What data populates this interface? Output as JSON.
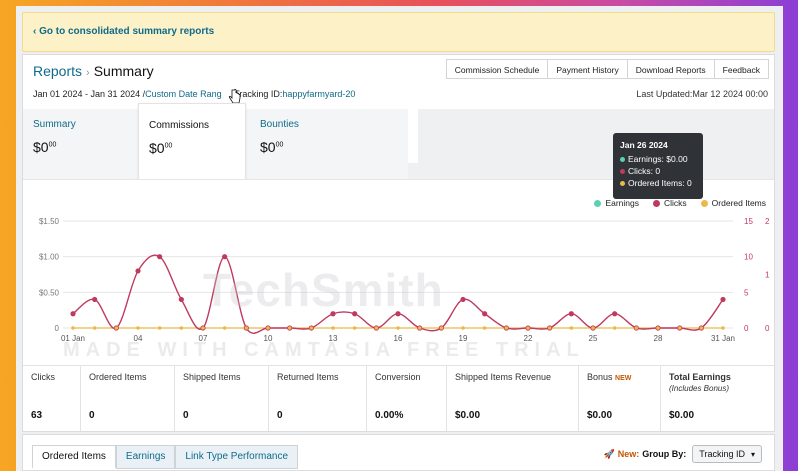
{
  "banner": {
    "link": "‹ Go to consolidated summary reports"
  },
  "breadcrumb": {
    "parent": "Reports",
    "separator": "›",
    "current": "Summary"
  },
  "top_tabs": [
    "Commission Schedule",
    "Payment History",
    "Download Reports",
    "Feedback"
  ],
  "date_row": {
    "range": "Jan 01 2024 - Jan 31 2024 /",
    "custom": "Custom Date Rang",
    "tracking_label": "Tracking ID:",
    "tracking_value": "happyfarmyard-20"
  },
  "last_updated": "Last Updated:Mar 12 2024 00:00",
  "summary_cards": [
    {
      "label": "Summary",
      "value": "$0",
      "cents": "00"
    },
    {
      "label": "Commissions",
      "value": "$0",
      "cents": "00"
    },
    {
      "label": "Bounties",
      "value": "$0",
      "cents": "00"
    }
  ],
  "legend": [
    {
      "name": "Earnings",
      "color": "#5ccfb5"
    },
    {
      "name": "Clicks",
      "color": "#c0395f"
    },
    {
      "name": "Ordered Items",
      "color": "#e9b949"
    }
  ],
  "tooltip": {
    "date": "Jan 26 2024",
    "earnings": "Earnings: $0.00",
    "clicks": "Clicks: 0",
    "ordered": "Ordered Items: 0"
  },
  "watermark": {
    "logo": "TechSmith",
    "text": "MADE WITH CAMTASIA FREE TRIAL"
  },
  "chart_data": {
    "type": "line",
    "x": [
      "01 Jan",
      "02",
      "03",
      "04",
      "05",
      "06",
      "07",
      "08",
      "09",
      "10",
      "11",
      "12",
      "13",
      "14",
      "15",
      "16",
      "17",
      "18",
      "19",
      "20",
      "21",
      "22",
      "23",
      "24",
      "25",
      "26",
      "27",
      "28",
      "29",
      "30",
      "31 Jan"
    ],
    "x_ticks": [
      "01 Jan",
      "04",
      "07",
      "10",
      "13",
      "16",
      "19",
      "22",
      "25",
      "28",
      "31 Jan"
    ],
    "y_left_ticks": [
      "0",
      "$0.50",
      "$1.00",
      "$1.50"
    ],
    "y_right1_ticks": [
      "0",
      "5",
      "10",
      "15"
    ],
    "y_right2_ticks": [
      "0",
      "1",
      "2"
    ],
    "series": [
      {
        "name": "Earnings",
        "values": [
          0,
          0,
          0,
          0,
          0,
          0,
          0,
          0,
          0,
          0,
          0,
          0,
          0,
          0,
          0,
          0,
          0,
          0,
          0,
          0,
          0,
          0,
          0,
          0,
          0,
          0,
          0,
          0,
          0,
          0,
          0
        ]
      },
      {
        "name": "Clicks",
        "values": [
          2,
          4,
          0,
          8,
          10,
          4,
          0,
          10,
          0,
          0,
          0,
          0,
          2,
          2,
          0,
          2,
          0,
          0,
          4,
          2,
          0,
          0,
          0,
          2,
          0,
          2,
          0,
          0,
          0,
          0,
          4
        ]
      },
      {
        "name": "Ordered Items",
        "values": [
          0,
          0,
          0,
          0,
          0,
          0,
          0,
          0,
          0,
          0,
          0,
          0,
          0,
          0,
          0,
          0,
          0,
          0,
          0,
          0,
          0,
          0,
          0,
          0,
          0,
          0,
          0,
          0,
          0,
          0,
          0
        ]
      }
    ],
    "ylim_left": [
      0,
      1.5
    ],
    "ylim_right1": [
      0,
      15
    ],
    "grid": true,
    "legend_position": "top-right"
  },
  "stats": [
    {
      "label": "Clicks",
      "value": "63"
    },
    {
      "label": "Ordered Items",
      "value": "0"
    },
    {
      "label": "Shipped Items",
      "value": "0"
    },
    {
      "label": "Returned Items",
      "value": "0"
    },
    {
      "label": "Conversion",
      "value": "0.00%"
    },
    {
      "label": "Shipped Items Revenue",
      "value": "$0.00"
    },
    {
      "label": "Bonus",
      "badge": "NEW",
      "value": "$0.00"
    },
    {
      "label": "Total Earnings",
      "sublabel": "(Includes Bonus)",
      "value": "$0.00"
    }
  ],
  "bottom_tabs": [
    "Ordered Items",
    "Earnings",
    "Link Type Performance"
  ],
  "group_by": {
    "new_label": "New:",
    "label": "Group By:",
    "selected": "Tracking ID"
  },
  "colors": {
    "link": "#0f6b8a",
    "clicks": "#c0395f",
    "ordered": "#e9b949",
    "earnings": "#5ccfb5"
  }
}
